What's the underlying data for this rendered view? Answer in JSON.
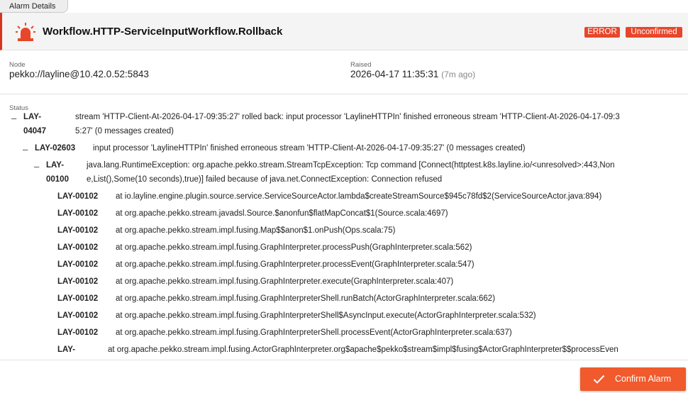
{
  "tab": {
    "label": "Alarm Details"
  },
  "header": {
    "icon": "alarm-siren-icon",
    "title": "Workflow.HTTP-ServiceInputWorkflow.Rollback",
    "badge_error": "ERROR",
    "badge_unconfirmed": "Unconfirmed",
    "accent_color": "#d9341f"
  },
  "info": {
    "node_label": "Node",
    "node_value": "pekko://layline@10.42.0.52:5843",
    "raised_label": "Raised",
    "raised_value": "2026-04-17 11:35:31",
    "raised_ago": "(7m ago)"
  },
  "status": {
    "label": "Status",
    "entries": [
      {
        "toggle": "–",
        "code_line1": "LAY-",
        "code_line2": "04047",
        "msg_line1": "stream 'HTTP-Client-At-2026-04-17-09:35:27' rolled back: input processor 'LaylineHTTPIn' finished erroneous stream 'HTTP-Client-At-2026-04-17-09:3",
        "msg_line2": "5:27' (0 messages created)"
      },
      {
        "toggle": "–",
        "code": "LAY-02603",
        "msg": "input processor 'LaylineHTTPIn' finished erroneous stream 'HTTP-Client-At-2026-04-17-09:35:27' (0 messages created)"
      },
      {
        "toggle": "–",
        "code_line1": "LAY-",
        "code_line2": "00100",
        "msg_line1": "java.lang.RuntimeException: org.apache.pekko.stream.StreamTcpException: Tcp command [Connect(httptest.k8s.layline.io/<unresolved>:443,Non",
        "msg_line2": "e,List(),Some(10 seconds),true)] failed because of java.net.ConnectException: Connection refused"
      },
      {
        "code": "LAY-00102",
        "msg": "at io.layline.engine.plugin.source.service.ServiceSourceActor.lambda$createStreamSource$945c78fd$2(ServiceSourceActor.java:894)"
      },
      {
        "code": "LAY-00102",
        "msg": "at org.apache.pekko.stream.javadsl.Source.$anonfun$flatMapConcat$1(Source.scala:4697)"
      },
      {
        "code": "LAY-00102",
        "msg": "at org.apache.pekko.stream.impl.fusing.Map$$anon$1.onPush(Ops.scala:75)"
      },
      {
        "code": "LAY-00102",
        "msg": "at org.apache.pekko.stream.impl.fusing.GraphInterpreter.processPush(GraphInterpreter.scala:562)"
      },
      {
        "code": "LAY-00102",
        "msg": "at org.apache.pekko.stream.impl.fusing.GraphInterpreter.processEvent(GraphInterpreter.scala:547)"
      },
      {
        "code": "LAY-00102",
        "msg": "at org.apache.pekko.stream.impl.fusing.GraphInterpreter.execute(GraphInterpreter.scala:407)"
      },
      {
        "code": "LAY-00102",
        "msg": "at org.apache.pekko.stream.impl.fusing.GraphInterpreterShell.runBatch(ActorGraphInterpreter.scala:662)"
      },
      {
        "code": "LAY-00102",
        "msg": "at org.apache.pekko.stream.impl.fusing.GraphInterpreterShell$AsyncInput.execute(ActorGraphInterpreter.scala:532)"
      },
      {
        "code": "LAY-00102",
        "msg": "at org.apache.pekko.stream.impl.fusing.GraphInterpreterShell.processEvent(ActorGraphInterpreter.scala:637)"
      },
      {
        "code_line1": "LAY-",
        "msg_line1": "at org.apache.pekko.stream.impl.fusing.ActorGraphInterpreter.org$apache$pekko$stream$impl$fusing$ActorGraphInterpreter$$processEven"
      }
    ]
  },
  "footer": {
    "confirm_label": "Confirm Alarm",
    "confirm_color": "#f05a2c",
    "confirm_icon": "check-icon"
  }
}
